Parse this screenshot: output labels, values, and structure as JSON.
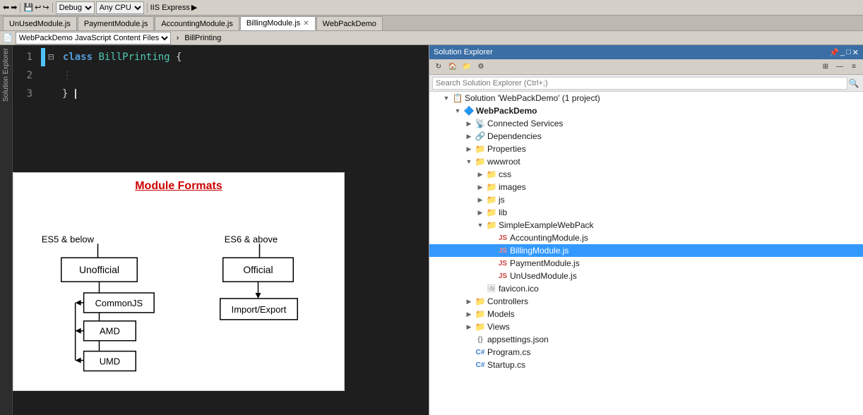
{
  "toolbar": {
    "debug_label": "Debug",
    "cpu_label": "Any CPU",
    "iis_label": "IIS Express",
    "controls": [
      "⬅",
      "➡",
      "✕",
      "💾",
      "📂",
      "💾",
      "↩",
      "↪"
    ]
  },
  "tabs": [
    {
      "label": "UnUsedModule.js",
      "active": false,
      "closable": false
    },
    {
      "label": "PaymentModule.js",
      "active": false,
      "closable": false
    },
    {
      "label": "AccountingModule.js",
      "active": false,
      "closable": false
    },
    {
      "label": "BillingModule.js",
      "active": true,
      "closable": true
    },
    {
      "label": "WebPackDemo",
      "active": false,
      "closable": false
    }
  ],
  "address_bar": {
    "text": "WebPackDemo JavaScript Content Files"
  },
  "vertical_tab_label": "Solution Explorer",
  "code": {
    "lines": [
      {
        "number": "1",
        "content": "class BillPrinting {",
        "has_collapse": true
      },
      {
        "number": "2",
        "content": "",
        "has_collapse": false
      },
      {
        "number": "3",
        "content": "}",
        "has_collapse": false
      }
    ]
  },
  "diagram": {
    "title": "Module Formats",
    "es5_label": "ES5 & below",
    "es6_label": "ES6 & above",
    "unofficial_label": "Unofficial",
    "official_label": "Official",
    "commonjs_label": "CommonJS",
    "amd_label": "AMD",
    "umd_label": "UMD",
    "importexport_label": "Import/Export"
  },
  "solution_explorer": {
    "title": "Solution Explorer",
    "search_placeholder": "Search Solution Explorer (Ctrl+;)",
    "solution_label": "Solution 'WebPackDemo' (1 project)",
    "tree": [
      {
        "id": "solution",
        "label": "Solution 'WebPackDemo' (1 project)",
        "indent": 0,
        "arrow": "▼",
        "icon": "📋",
        "icon_class": "icon-solution"
      },
      {
        "id": "webpackdemo",
        "label": "WebPackDemo",
        "indent": 1,
        "arrow": "▼",
        "icon": "🔷",
        "icon_class": "icon-project",
        "bold": true
      },
      {
        "id": "connected",
        "label": "Connected Services",
        "indent": 2,
        "arrow": "▶",
        "icon": "📡",
        "icon_class": "icon-folder"
      },
      {
        "id": "dependencies",
        "label": "Dependencies",
        "indent": 2,
        "arrow": "▶",
        "icon": "🔗",
        "icon_class": "icon-folder"
      },
      {
        "id": "properties",
        "label": "Properties",
        "indent": 2,
        "arrow": "▶",
        "icon": "📁",
        "icon_class": "icon-folder"
      },
      {
        "id": "wwwroot",
        "label": "wwwroot",
        "indent": 2,
        "arrow": "▼",
        "icon": "📁",
        "icon_class": "icon-folder"
      },
      {
        "id": "css",
        "label": "css",
        "indent": 3,
        "arrow": "▶",
        "icon": "📁",
        "icon_class": "icon-folder"
      },
      {
        "id": "images",
        "label": "images",
        "indent": 3,
        "arrow": "▶",
        "icon": "📁",
        "icon_class": "icon-folder"
      },
      {
        "id": "js",
        "label": "js",
        "indent": 3,
        "arrow": "▶",
        "icon": "📁",
        "icon_class": "icon-folder"
      },
      {
        "id": "lib",
        "label": "lib",
        "indent": 3,
        "arrow": "▶",
        "icon": "📁",
        "icon_class": "icon-folder"
      },
      {
        "id": "simpleexample",
        "label": "SimpleExampleWebPack",
        "indent": 3,
        "arrow": "▼",
        "icon": "📁",
        "icon_class": "icon-folder"
      },
      {
        "id": "accountingmodule",
        "label": "AccountingModule.js",
        "indent": 4,
        "arrow": "",
        "icon": "JS",
        "icon_class": "icon-js"
      },
      {
        "id": "billingmodule",
        "label": "BillingModule.js",
        "indent": 4,
        "arrow": "",
        "icon": "JS",
        "icon_class": "icon-js",
        "selected": true
      },
      {
        "id": "paymentmodule",
        "label": "PaymentModule.js",
        "indent": 4,
        "arrow": "",
        "icon": "JS",
        "icon_class": "icon-js"
      },
      {
        "id": "unusedmodule",
        "label": "UnUsedModule.js",
        "indent": 4,
        "arrow": "",
        "icon": "JS",
        "icon_class": "icon-js"
      },
      {
        "id": "favicon",
        "label": "favicon.ico",
        "indent": 3,
        "arrow": "",
        "icon": "🖼",
        "icon_class": "icon-ico"
      },
      {
        "id": "controllers",
        "label": "Controllers",
        "indent": 2,
        "arrow": "▶",
        "icon": "📁",
        "icon_class": "icon-folder"
      },
      {
        "id": "models",
        "label": "Models",
        "indent": 2,
        "arrow": "▶",
        "icon": "📁",
        "icon_class": "icon-folder"
      },
      {
        "id": "views",
        "label": "Views",
        "indent": 2,
        "arrow": "▶",
        "icon": "📁",
        "icon_class": "icon-folder"
      },
      {
        "id": "appsettings",
        "label": "appsettings.json",
        "indent": 2,
        "arrow": "",
        "icon": "{}",
        "icon_class": "icon-json"
      },
      {
        "id": "program",
        "label": "Program.cs",
        "indent": 2,
        "arrow": "",
        "icon": "C#",
        "icon_class": "icon-cs"
      },
      {
        "id": "startup",
        "label": "Startup.cs",
        "indent": 2,
        "arrow": "",
        "icon": "C#",
        "icon_class": "icon-cs"
      }
    ]
  },
  "colors": {
    "active_tab_bg": "#ffffff",
    "editor_bg": "#1e1e1e",
    "keyword_blue": "#569cd6",
    "class_name_teal": "#4ec9b0",
    "line_number_color": "#858585",
    "green_bar": "#4fc3f7",
    "se_title_bg": "#3a6ea5",
    "diagram_title_color": "#cc0000"
  }
}
